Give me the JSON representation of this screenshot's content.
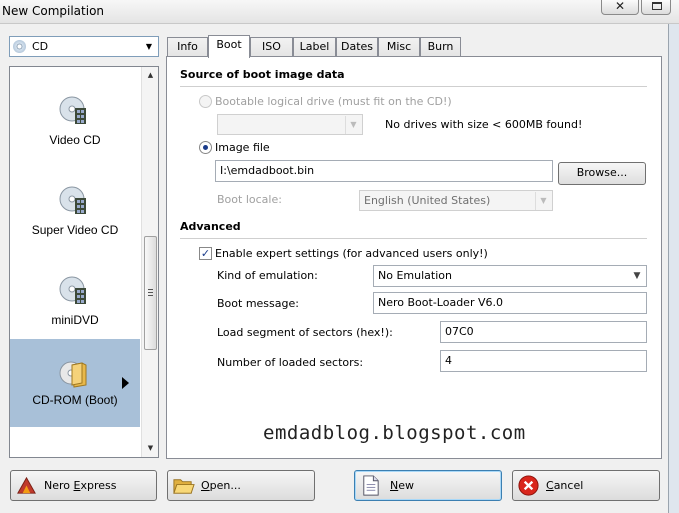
{
  "window": {
    "title": "New Compilation",
    "close_label": "✕"
  },
  "media": {
    "combo_value": "CD",
    "items": [
      {
        "label": "Video CD"
      },
      {
        "label": "Super Video CD"
      },
      {
        "label": "miniDVD"
      },
      {
        "label": "CD-ROM (Boot)"
      }
    ]
  },
  "tabs": [
    "Info",
    "Boot",
    "ISO",
    "Label",
    "Dates",
    "Misc",
    "Burn"
  ],
  "boot": {
    "source_title": "Source of boot image data",
    "logical_drive_label": "Bootable logical drive (must fit on the CD!)",
    "no_drives_msg": "No drives with size < 600MB found!",
    "image_file_label": "Image file",
    "image_file_value": "I:\\emdadboot.bin",
    "browse_label": "Browse...",
    "boot_locale_label": "Boot locale:",
    "boot_locale_value": "English (United States)",
    "advanced_title": "Advanced",
    "expert_label": "Enable expert settings (for advanced users only!)",
    "emulation_label": "Kind of emulation:",
    "emulation_value": "No Emulation",
    "message_label": "Boot message:",
    "message_value": "Nero Boot-Loader V6.0",
    "segment_label": "Load segment of sectors (hex!):",
    "segment_value": "07C0",
    "sectors_label": "Number of loaded sectors:",
    "sectors_value": "4"
  },
  "watermark": "emdadblog.blogspot.com",
  "buttons": {
    "nero_express_prefix": "Nero ",
    "nero_express_u": "E",
    "nero_express_suffix": "xpress",
    "open_u": "O",
    "open_suffix": "pen...",
    "new_u": "N",
    "new_suffix": "ew",
    "cancel_u": "C",
    "cancel_suffix": "ancel"
  },
  "colors": {
    "selection": "#a8c0d8",
    "accent": "#3c7fb1"
  },
  "icons": {
    "media": "disc-with-film-icon",
    "boot": "folder-disc-icon",
    "nero_express": "nero-express-icon",
    "open": "open-folder-icon",
    "new": "new-document-icon",
    "cancel": "cancel-icon"
  }
}
